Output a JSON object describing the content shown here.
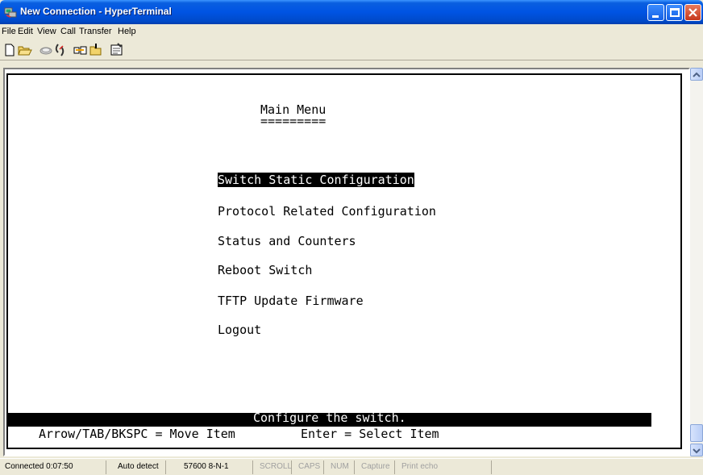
{
  "window": {
    "title": "New Connection - HyperTerminal"
  },
  "menu": [
    "File",
    "Edit",
    "View",
    "Call",
    "Transfer",
    "Help"
  ],
  "toolbar": {
    "buttons": [
      "new-document-icon",
      "open-folder-icon",
      "dial-icon",
      "disconnect-icon",
      "send-icon",
      "receive-icon",
      "properties-icon"
    ]
  },
  "terminal": {
    "title": "Main Menu",
    "underline": "=========",
    "items": [
      "Switch Static Configuration",
      "Protocol Related Configuration",
      "Status and Counters",
      "Reboot Switch",
      "TFTP Update Firmware",
      "Logout"
    ],
    "selected_index": 0,
    "status_message": "Configure the switch.",
    "help_move": "Arrow/TAB/BKSPC = Move Item",
    "help_select": "Enter = Select Item"
  },
  "statusbar": {
    "connected": "Connected 0:07:50",
    "detect": "Auto detect",
    "settings": "57600 8-N-1",
    "scroll": "SCROLL",
    "caps": "CAPS",
    "num": "NUM",
    "capture": "Capture",
    "print_echo": "Print echo"
  },
  "colors": {
    "titlebar": "#0054e3",
    "terminal_bg": "#ffffff",
    "terminal_fg": "#000000"
  }
}
